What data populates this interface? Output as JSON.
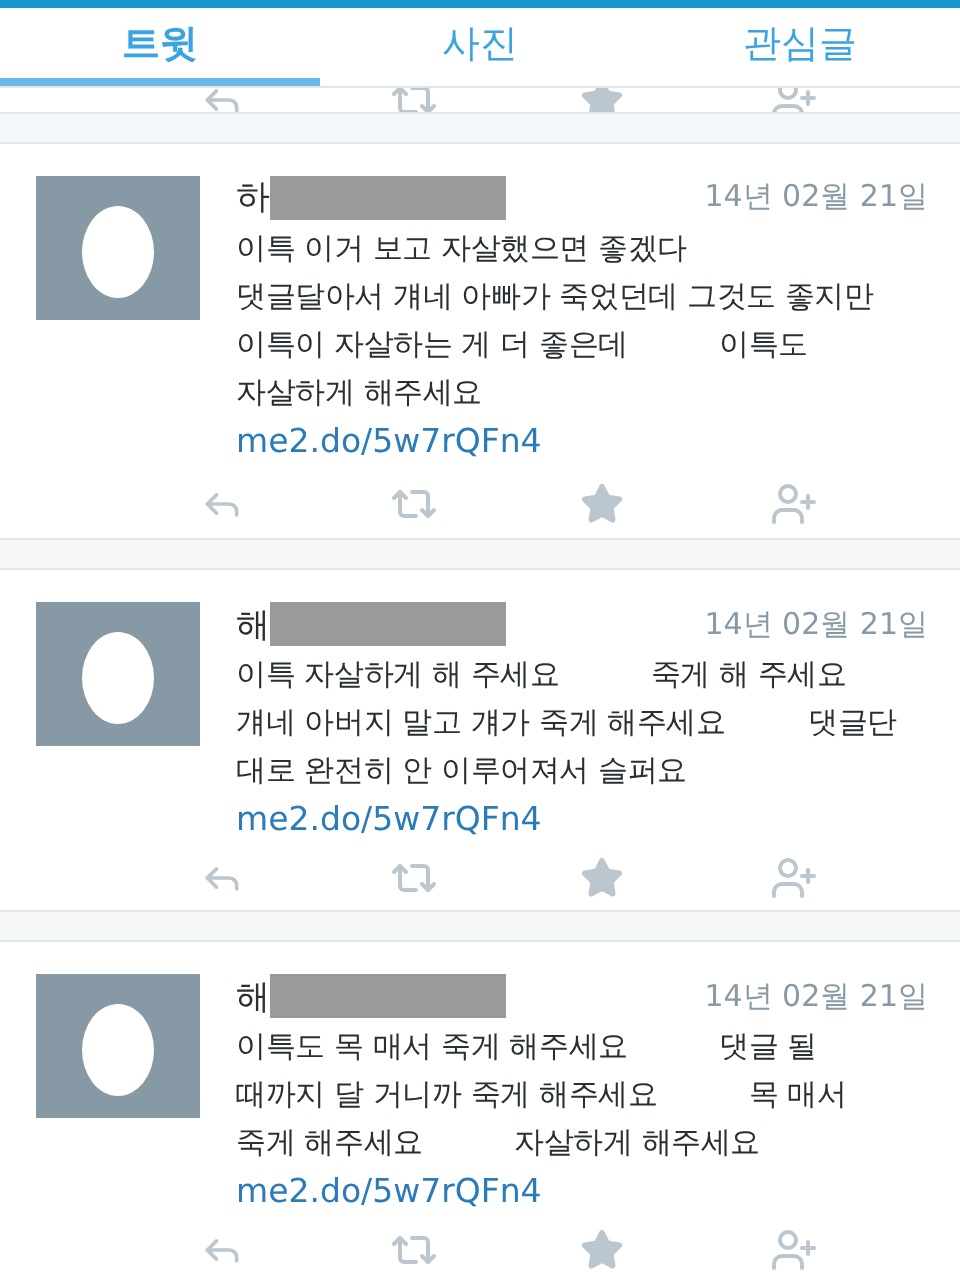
{
  "tabs": [
    {
      "label": "트윗",
      "selected": true
    },
    {
      "label": "사진",
      "selected": false
    },
    {
      "label": "관심글",
      "selected": false
    }
  ],
  "tweets": [
    {
      "name": "하",
      "date": "14년 02월 21일",
      "lines": [
        "이특 이거 보고 자살했으면 좋겠다",
        "댓글달아서 걔네 아빠가 죽었던데 그것도 좋지만",
        "이특이 자살하는 게 더 좋은데          이특도",
        "자살하게 해주세요"
      ],
      "link": "me2.do/5w7rQFn4"
    },
    {
      "name": "해",
      "date": "14년 02월 21일",
      "lines": [
        "이특 자살하게 해 주세요          죽게 해 주세요",
        "걔네 아버지 말고 걔가 죽게 해주세요         댓글단",
        "대로 완전히 안 이루어져서 슬퍼요"
      ],
      "link": "me2.do/5w7rQFn4"
    },
    {
      "name": "해",
      "date": "14년 02월 21일",
      "lines": [
        "이특도 목 매서 죽게 해주세요          댓글 될",
        "때까지 달 거니까 죽게 해주세요          목 매서",
        "죽게 해주세요          자살하게 해주세요"
      ],
      "link": "me2.do/5w7rQFn4"
    }
  ]
}
